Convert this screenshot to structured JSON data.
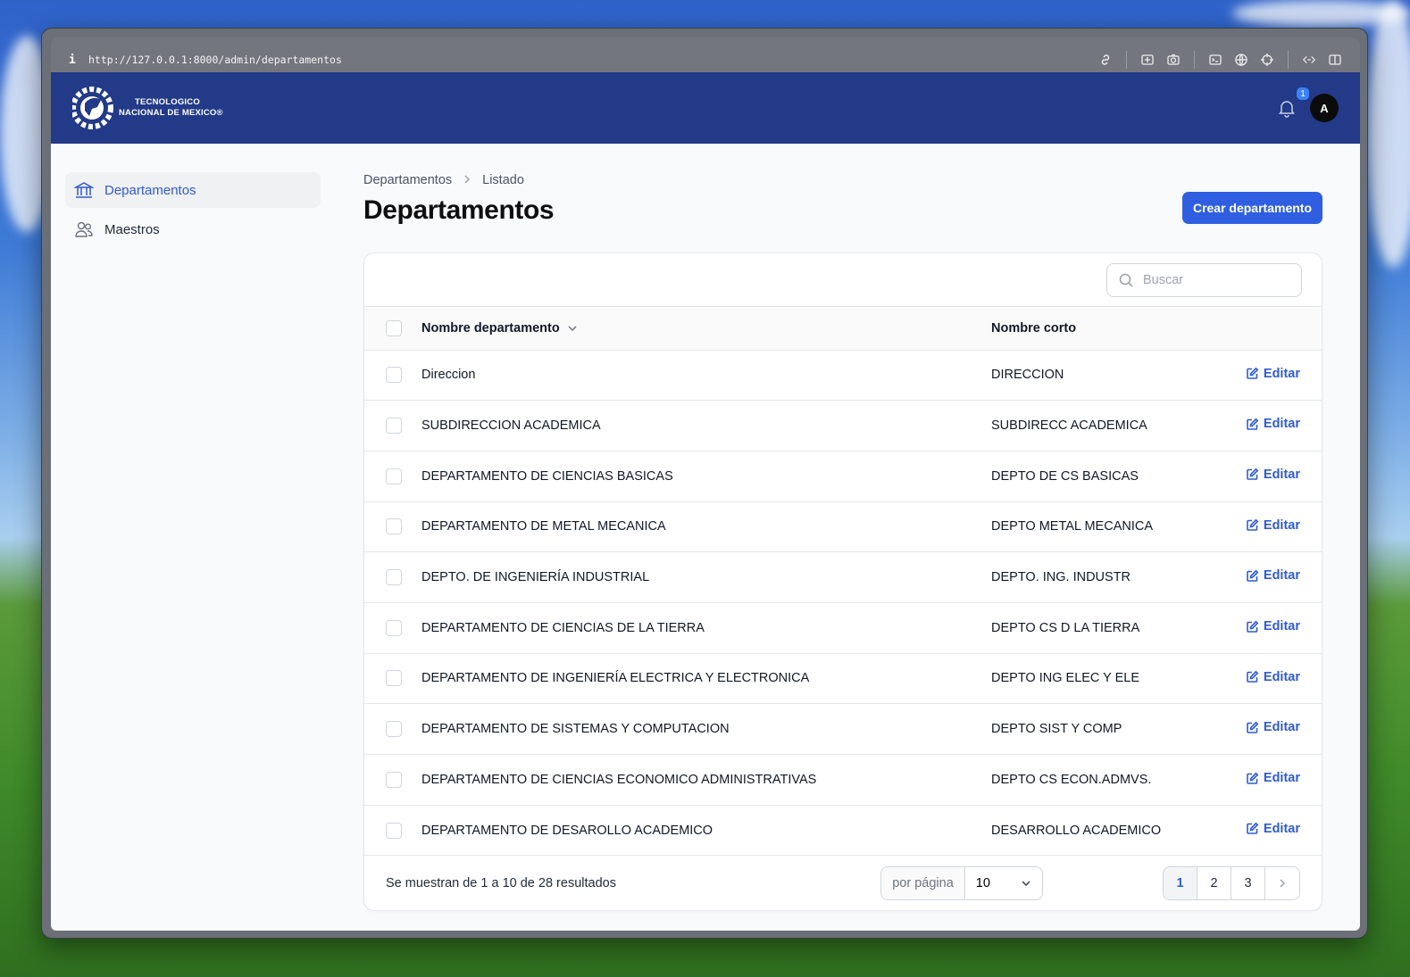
{
  "browser": {
    "info_glyph": "i",
    "url": "http://127.0.0.1:8000/admin/departamentos"
  },
  "header": {
    "logo_line1": "TECNOLOGICO",
    "logo_line2": "NACIONAL DE MEXICO®",
    "notification_count": "1",
    "avatar_initial": "A",
    "brand_color": "#233a88"
  },
  "sidebar": {
    "items": [
      {
        "label": "Departamentos",
        "icon": "building-columns-icon",
        "active": true
      },
      {
        "label": "Maestros",
        "icon": "users-icon",
        "active": false
      }
    ]
  },
  "breadcrumb": {
    "root": "Departamentos",
    "current": "Listado"
  },
  "page": {
    "title": "Departamentos",
    "create_button": "Crear departamento",
    "accent_color": "#2f5fe0"
  },
  "search": {
    "placeholder": "Buscar"
  },
  "table": {
    "columns": {
      "name": "Nombre departamento",
      "short": "Nombre corto"
    },
    "edit_label": "Editar",
    "rows": [
      {
        "name": "Direccion",
        "short": "DIRECCION"
      },
      {
        "name": "SUBDIRECCION ACADEMICA",
        "short": "SUBDIRECC ACADEMICA"
      },
      {
        "name": "DEPARTAMENTO DE CIENCIAS BASICAS",
        "short": "DEPTO DE CS BASICAS"
      },
      {
        "name": "DEPARTAMENTO DE METAL MECANICA",
        "short": "DEPTO METAL MECANICA"
      },
      {
        "name": "DEPTO. DE INGENIERÍA INDUSTRIAL",
        "short": "DEPTO. ING. INDUSTR"
      },
      {
        "name": "DEPARTAMENTO DE CIENCIAS DE LA TIERRA",
        "short": "DEPTO CS D LA TIERRA"
      },
      {
        "name": "DEPARTAMENTO DE INGENIERÍA ELECTRICA Y ELECTRONICA",
        "short": "DEPTO ING ELEC Y ELE"
      },
      {
        "name": "DEPARTAMENTO DE SISTEMAS Y COMPUTACION",
        "short": "DEPTO SIST Y COMP"
      },
      {
        "name": "DEPARTAMENTO DE CIENCIAS ECONOMICO ADMINISTRATIVAS",
        "short": "DEPTO CS ECON.ADMVS."
      },
      {
        "name": "DEPARTAMENTO DE DESAROLLO ACADEMICO",
        "short": "DESARROLLO ACADEMICO"
      }
    ]
  },
  "pagination": {
    "summary": "Se muestran de 1 a 10 de 28 resultados",
    "per_page_label": "por página",
    "per_page_value": "10",
    "pages": [
      "1",
      "2",
      "3"
    ],
    "current_page": "1"
  }
}
